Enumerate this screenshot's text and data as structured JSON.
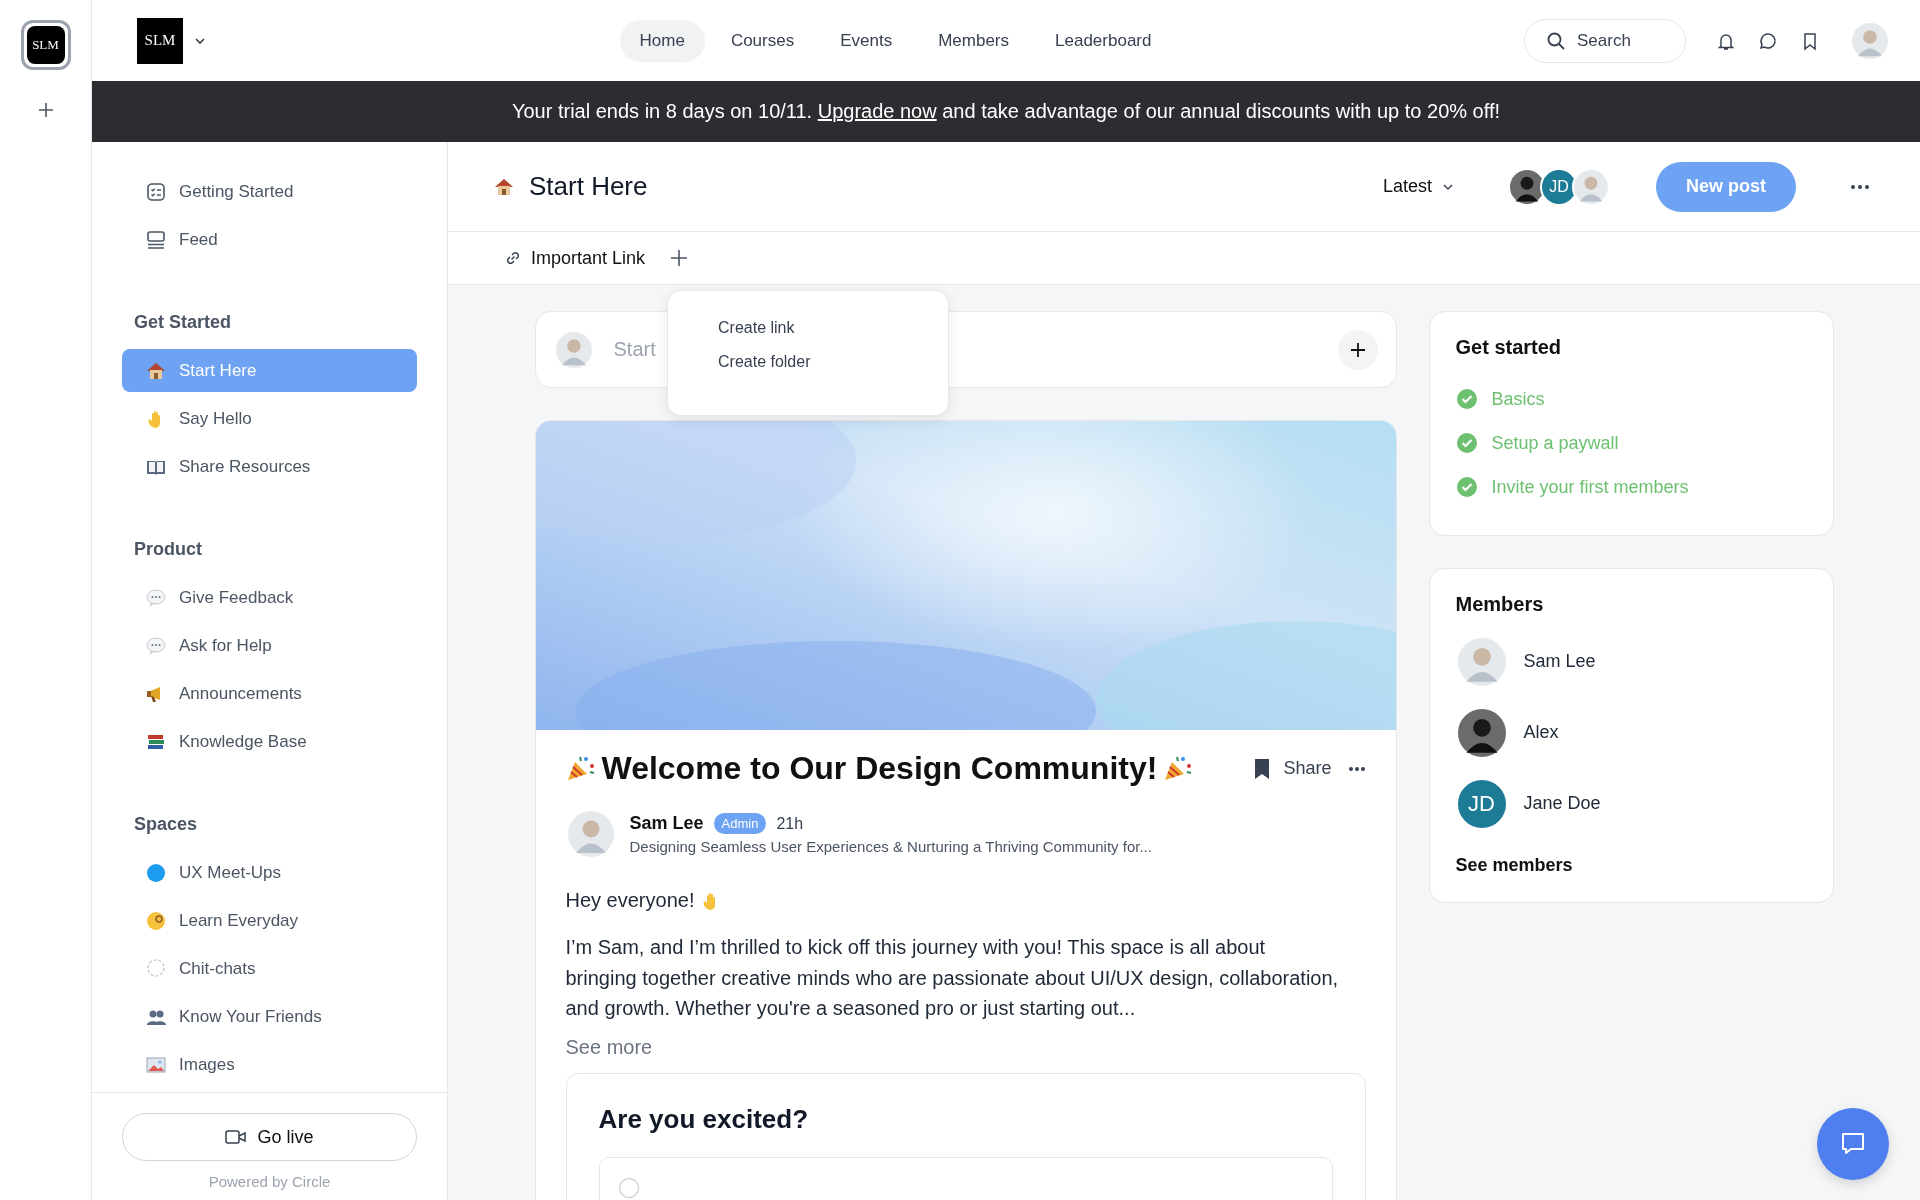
{
  "rail": {
    "logo": "SLM"
  },
  "topbar": {
    "logo": "SLM",
    "nav": [
      {
        "label": "Home",
        "selected": true
      },
      {
        "label": "Courses",
        "selected": false
      },
      {
        "label": "Events",
        "selected": false
      },
      {
        "label": "Members",
        "selected": false
      },
      {
        "label": "Leaderboard",
        "selected": false
      }
    ],
    "search": {
      "placeholder": "Search"
    }
  },
  "banner": {
    "before": "Your trial ends in 8 days on 10/11.",
    "link": "Upgrade now",
    "after": "and take advantage of our annual discounts with up to 20% off!"
  },
  "sidebar": {
    "top_items": [
      {
        "label": "Getting Started",
        "kind": "checklist",
        "selected": false
      },
      {
        "label": "Feed",
        "kind": "feed",
        "selected": false
      }
    ],
    "sections": [
      {
        "title": "Get Started",
        "items": [
          {
            "label": "Start Here",
            "kind": "house",
            "selected": true
          },
          {
            "label": "Say Hello",
            "kind": "wave",
            "selected": false
          },
          {
            "label": "Share Resources",
            "kind": "book",
            "selected": false
          }
        ]
      },
      {
        "title": "Product",
        "items": [
          {
            "label": "Give Feedback",
            "kind": "speech",
            "selected": false
          },
          {
            "label": "Ask for Help",
            "kind": "speech",
            "selected": false
          },
          {
            "label": "Announcements",
            "kind": "megaphone",
            "selected": false
          },
          {
            "label": "Knowledge Base",
            "kind": "books",
            "selected": false
          }
        ]
      },
      {
        "title": "Spaces",
        "items": [
          {
            "label": "UX Meet-Ups",
            "kind": "dot",
            "selected": false
          },
          {
            "label": "Learn Everyday",
            "kind": "face",
            "selected": false
          },
          {
            "label": "Chit-chats",
            "kind": "bubble",
            "selected": false
          },
          {
            "label": "Know Your Friends",
            "kind": "people",
            "selected": false
          },
          {
            "label": "Images",
            "selected": false
          }
        ]
      }
    ],
    "go_live": "Go live",
    "powered_by": "Powered by Circle"
  },
  "header": {
    "title": "Start Here",
    "sort": "Latest",
    "avatars": [
      {
        "kind": "photo_dark"
      },
      {
        "kind": "initials",
        "initials": "JD"
      },
      {
        "kind": "photo_light"
      }
    ],
    "new_post": "New post"
  },
  "link_bar": {
    "link": "Important Link"
  },
  "menu": {
    "items": [
      "Create link",
      "Create folder"
    ]
  },
  "composer": {
    "placeholder": "Start"
  },
  "post": {
    "cover": {
      "kind": "gradient"
    },
    "title": "Welcome to Our Design Community!",
    "share": "Share",
    "author": "Sam Lee",
    "badge": "Admin",
    "time": "21h",
    "headline": "Designing Seamless User Experiences & Nurturing a Thriving Community for...",
    "greeting": "Hey everyone!",
    "body": "I’m Sam, and I’m thrilled to kick off this journey with you! This space is all about bringing together creative minds who are passionate about UI/UX design, collaboration, and growth. Whether you're a seasoned pro or just starting out...",
    "see_more": "See more",
    "poll": {
      "question": "Are you excited?"
    }
  },
  "get_started": {
    "title": "Get started",
    "tasks": [
      {
        "label": "Basics",
        "checked": true
      },
      {
        "label": "Setup a paywall",
        "checked": true
      },
      {
        "label": "Invite your first members",
        "checked": true
      }
    ]
  },
  "members": {
    "title": "Members",
    "items": [
      {
        "name": "Sam Lee",
        "avatar": {
          "kind": "photo_light"
        }
      },
      {
        "name": "Alex",
        "avatar": {
          "kind": "photo_dark"
        }
      },
      {
        "name": "Jane Doe",
        "avatar": {
          "kind": "initials",
          "initials": "JD"
        }
      }
    ],
    "see_all": "See members"
  }
}
